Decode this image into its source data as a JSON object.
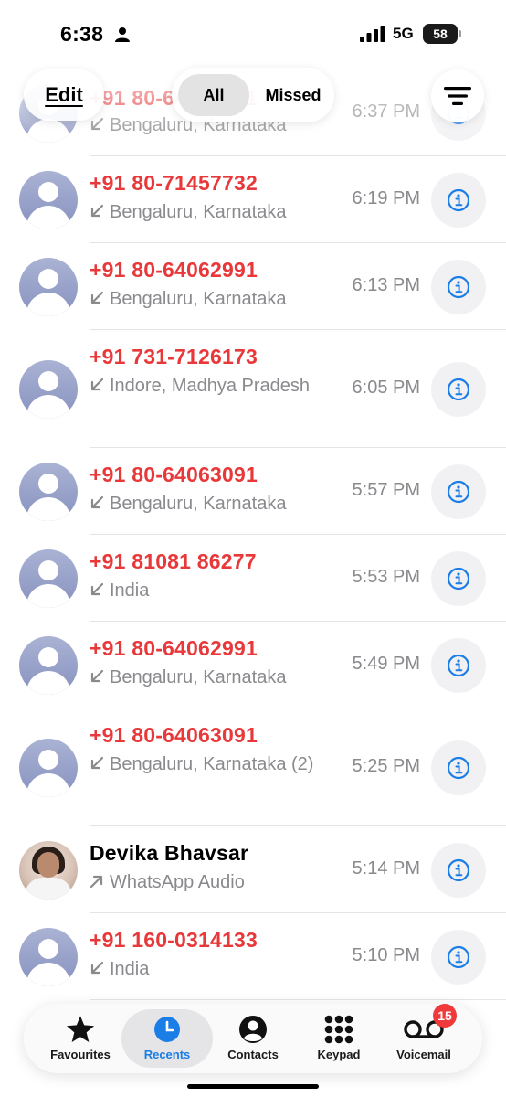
{
  "status_bar": {
    "time": "6:38",
    "network": "5G",
    "battery": "58",
    "icons": [
      "person-icon",
      "signal-icon",
      "battery-icon"
    ]
  },
  "header": {
    "edit_label": "Edit",
    "segments": [
      "All",
      "Missed"
    ],
    "selected_segment": "All",
    "filter_icon": "filter-lines-icon"
  },
  "calls": [
    {
      "number": "+91 80-64062991",
      "location": "Bengaluru, Karnataka",
      "direction": "incoming",
      "time": "6:37 PM",
      "missed": true
    },
    {
      "number": "+91 80-71457732",
      "location": "Bengaluru, Karnataka",
      "direction": "incoming",
      "time": "6:19 PM",
      "missed": true
    },
    {
      "number": "+91 80-64062991",
      "location": "Bengaluru, Karnataka",
      "direction": "incoming",
      "time": "6:13 PM",
      "missed": true
    },
    {
      "number": "+91 731-7126173",
      "location": "Indore, Madhya Pradesh",
      "direction": "incoming",
      "time": "6:05 PM",
      "missed": true
    },
    {
      "number": "+91 80-64063091",
      "location": "Bengaluru, Karnataka",
      "direction": "incoming",
      "time": "5:57 PM",
      "missed": true
    },
    {
      "number": "+91 81081 86277",
      "location": "India",
      "direction": "incoming",
      "time": "5:53 PM",
      "missed": true
    },
    {
      "number": "+91 80-64062991",
      "location": "Bengaluru, Karnataka",
      "direction": "incoming",
      "time": "5:49 PM",
      "missed": true
    },
    {
      "number": "+91 80-64063091",
      "location": "Bengaluru, Karnataka (2)",
      "direction": "incoming",
      "time": "5:25 PM",
      "missed": true
    },
    {
      "number": "Devika Bhavsar",
      "location": "WhatsApp Audio",
      "direction": "outgoing",
      "time": "5:14 PM",
      "missed": false
    },
    {
      "number": "+91 160-0314133",
      "location": "India",
      "direction": "incoming",
      "time": "5:10 PM",
      "missed": true
    }
  ],
  "tab_bar": {
    "tabs": [
      {
        "label": "Favourites",
        "icon": "star-icon"
      },
      {
        "label": "Recents",
        "icon": "clock-icon"
      },
      {
        "label": "Contacts",
        "icon": "person-circle-icon"
      },
      {
        "label": "Keypad",
        "icon": "keypad-icon"
      },
      {
        "label": "Voicemail",
        "icon": "voicemail-icon"
      }
    ],
    "selected_tab": "Recents",
    "voicemail_badge": "15"
  },
  "colors": {
    "missed": "#e8383a",
    "accent": "#1a7ee6",
    "secondary_text": "#8a8a8e",
    "badge": "#f0393b"
  }
}
